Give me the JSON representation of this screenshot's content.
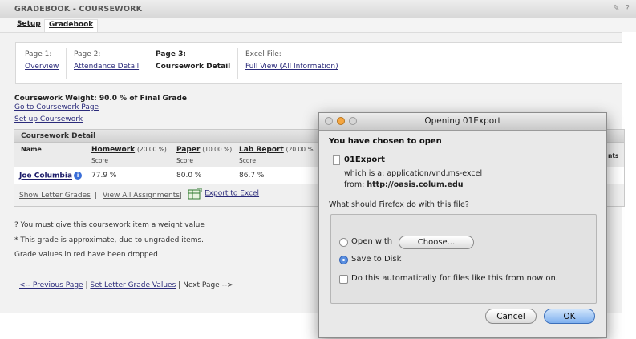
{
  "header": {
    "title": "GRADEBOOK - COURSEWORK",
    "tools": [
      "✎",
      "?"
    ]
  },
  "tabs": [
    "Setup",
    "Gradebook"
  ],
  "steps": [
    {
      "label": "Page 1:",
      "link": "Overview"
    },
    {
      "label": "Page 2:",
      "link": "Attendance Detail"
    },
    {
      "label": "Page 3:",
      "link": "Coursework Detail"
    },
    {
      "label": "Excel File:",
      "link": "Full View (All Information)"
    }
  ],
  "weight_text": "Coursework Weight: 90.0 % of Final Grade",
  "goto_link": "Go to Coursework Page",
  "setup_link": "Set up Coursework",
  "table": {
    "title": "Coursework Detail",
    "name_header": "Name",
    "columns": [
      {
        "name": "Homework",
        "weight": "(20.00 %)",
        "sub": "Score"
      },
      {
        "name": "Paper",
        "weight": "(10.00 %)",
        "sub": "Score"
      },
      {
        "name": "Lab Report",
        "weight": "(20.00 %",
        "sub": "Score"
      }
    ],
    "partial_right_header": "nts",
    "rows": [
      {
        "name": "Joe Columbia",
        "values": [
          "77.9 %",
          "80.0 %",
          "86.7 %"
        ]
      }
    ],
    "toolbar": {
      "show_letter": "Show Letter Grades",
      "sep": "|",
      "view_all": "View All Assignments",
      "export": "Export to Excel"
    }
  },
  "notes": [
    "? You must give this coursework item a weight value",
    "* This grade is approximate, due to ungraded items.",
    "Grade values in red have been dropped"
  ],
  "bottom_nav": {
    "prev": "<-- Previous Page",
    "sep": "|",
    "set_letter": "Set Letter Grade Values",
    "next": "Next Page -->"
  },
  "dialog": {
    "title": "Opening 01Export",
    "intro": "You have chosen to open",
    "filename": "01Export",
    "which_is": "which is a: application/vnd.ms-excel",
    "from_label": "from:",
    "from_url": "http://oasis.colum.edu",
    "question": "What should Firefox do with this file?",
    "open_with": "Open with",
    "choose": "Choose...",
    "save_to_disk": "Save to Disk",
    "auto": "Do this automatically for files like this from now on.",
    "selected_option": "save_to_disk",
    "cancel": "Cancel",
    "ok": "OK"
  }
}
